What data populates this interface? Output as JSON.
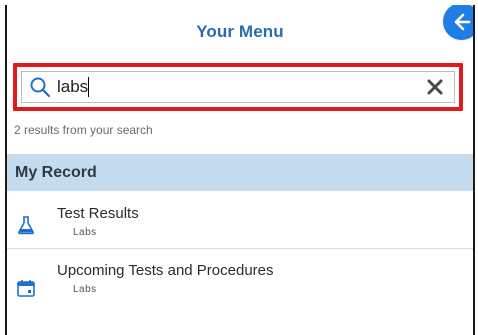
{
  "header": {
    "title": "Your Menu",
    "back_icon": "back-arrow-icon"
  },
  "search": {
    "value": "labs",
    "search_icon": "search-icon",
    "clear_icon": "close-icon",
    "highlight_color": "#e01b1b"
  },
  "results": {
    "count_text": "2 results from your search"
  },
  "section": {
    "title": "My Record",
    "background": "#c5dcef"
  },
  "items": [
    {
      "title": "Test Results",
      "subtitle": "Labs",
      "icon": "flask-icon"
    },
    {
      "title": "Upcoming Tests and Procedures",
      "subtitle": "Labs",
      "icon": "calendar-icon"
    }
  ],
  "colors": {
    "accent": "#2b6cb0",
    "button": "#1e7ee6"
  }
}
